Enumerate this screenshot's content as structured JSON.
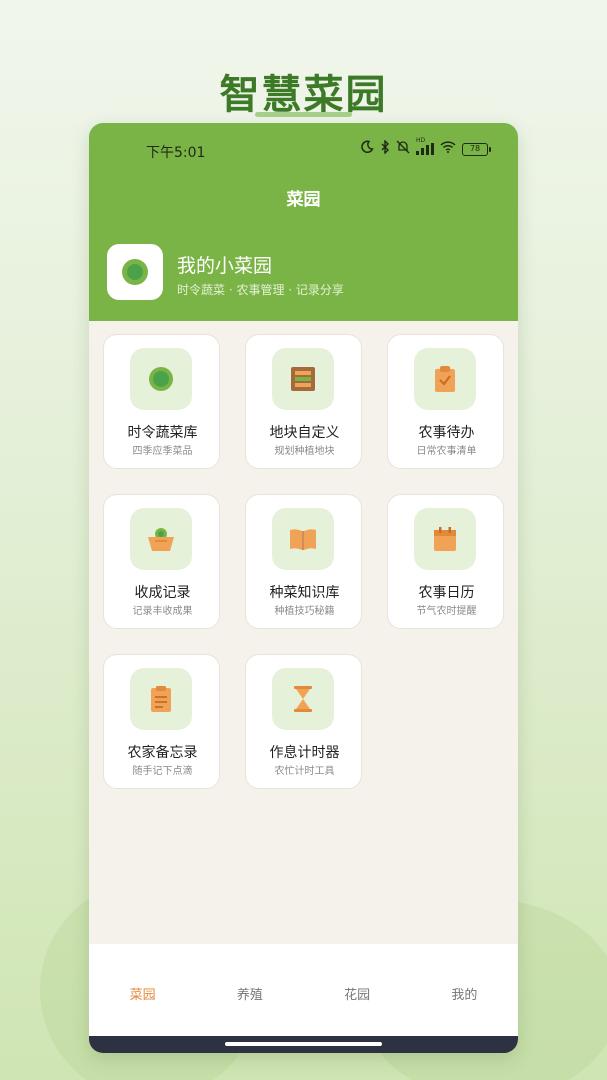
{
  "promo": {
    "title": "智慧菜园"
  },
  "status_bar": {
    "time": "下午5:01",
    "network_badge": "HD",
    "battery": "78"
  },
  "nav": {
    "title": "菜园"
  },
  "garden": {
    "name": "我的小菜园",
    "tagline": "时令蔬菜 · 农事管理 · 记录分享"
  },
  "features": [
    {
      "title": "时令蔬菜库",
      "subtitle": "四季应季菜品",
      "icon": "vegetable-icon"
    },
    {
      "title": "地块自定义",
      "subtitle": "规划种植地块",
      "icon": "plot-grid-icon"
    },
    {
      "title": "农事待办",
      "subtitle": "日常农事清单",
      "icon": "clipboard-check-icon"
    },
    {
      "title": "收成记录",
      "subtitle": "记录丰收成果",
      "icon": "harvest-basket-icon"
    },
    {
      "title": "种菜知识库",
      "subtitle": "种植技巧秘籍",
      "icon": "book-icon"
    },
    {
      "title": "农事日历",
      "subtitle": "节气农时提醒",
      "icon": "calendar-icon"
    },
    {
      "title": "农家备忘录",
      "subtitle": "随手记下点滴",
      "icon": "memo-icon"
    },
    {
      "title": "作息计时器",
      "subtitle": "农忙计时工具",
      "icon": "hourglass-icon"
    }
  ],
  "tabs": [
    {
      "label": "菜园",
      "active": true
    },
    {
      "label": "养殖",
      "active": false
    },
    {
      "label": "花园",
      "active": false
    },
    {
      "label": "我的",
      "active": false
    }
  ],
  "colors": {
    "header_green": "#7bb446",
    "promo_green": "#3d7a27",
    "active_tab": "#e3893a",
    "icon_orange": "#f0a356",
    "icon_bg": "#e6f1d9"
  }
}
